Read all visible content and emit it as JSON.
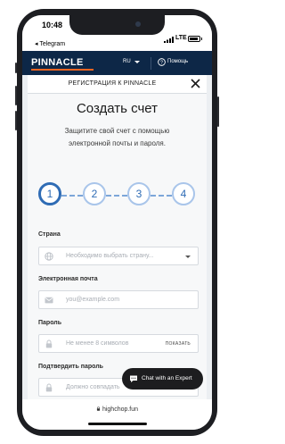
{
  "status_bar": {
    "time": "10:48",
    "back_app": "◂ Telegram",
    "network": "LTE"
  },
  "brand_bar": {
    "logo": "PINNACLE",
    "language": "RU",
    "help_label": "Помощь"
  },
  "modal": {
    "title": "РЕГИСТРАЦИЯ К PINNACLE",
    "heading": "Создать счет",
    "subtitle_line1": "Защитите свой счет с помощью",
    "subtitle_line2": "электронной почты и пароля."
  },
  "steps": [
    "1",
    "2",
    "3",
    "4"
  ],
  "active_step": 1,
  "form": {
    "country_label": "Страна",
    "country_placeholder": "Необходимо выбрать страну...",
    "email_label": "Электронная почта",
    "email_placeholder": "you@example.com",
    "password_label": "Пароль",
    "password_placeholder": "Не менее 8 символов",
    "show_label": "ПОКАЗАТЬ",
    "confirm_label": "Подтвердить пароль",
    "confirm_placeholder": "Должно совпадать"
  },
  "chat": {
    "label": "Chat with an Expert"
  },
  "browser": {
    "url": "highchop.fun"
  },
  "battery_level": 0.9,
  "colors": {
    "brand_navy": "#0d2747",
    "brand_orange": "#f26522",
    "step_blue": "#2f6cb5",
    "chat_bg": "#1d1d1f"
  },
  "icons": [
    "globe-icon",
    "mail-icon",
    "lock-icon",
    "close-icon",
    "help-icon",
    "chat-bubble-icon"
  ]
}
